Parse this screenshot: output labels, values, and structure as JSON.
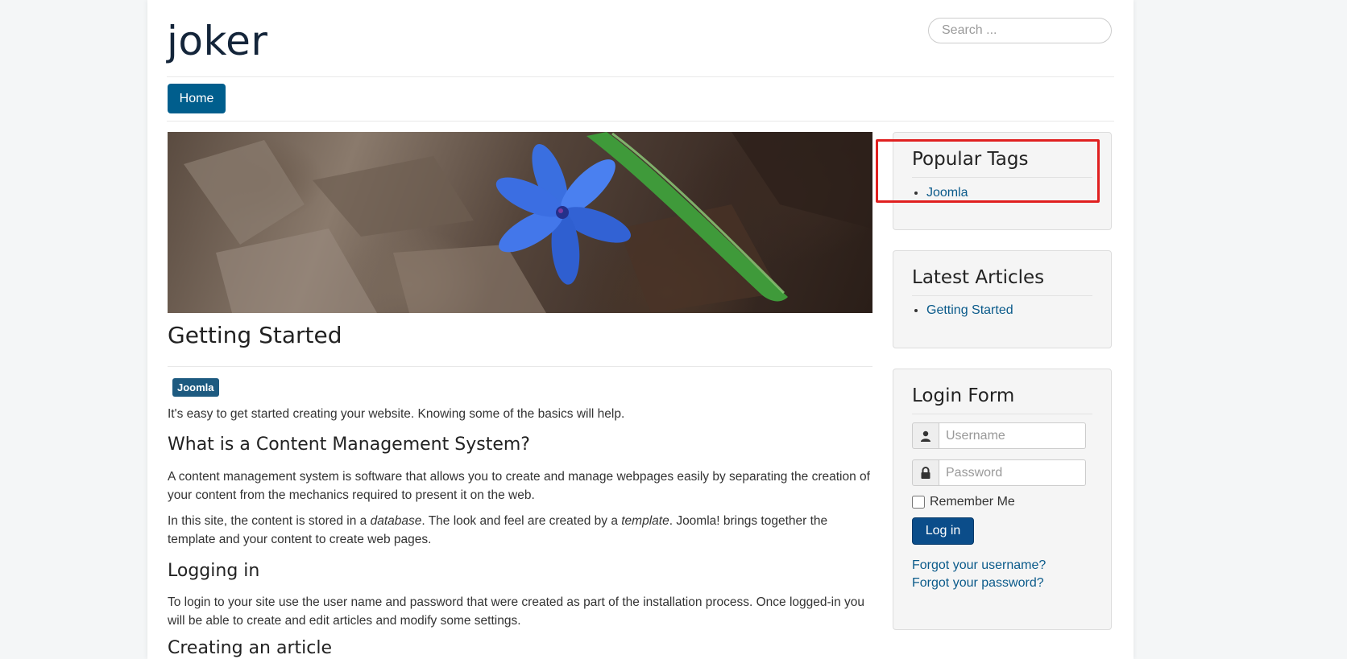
{
  "site": {
    "brand": "joker"
  },
  "search": {
    "placeholder": "Search ..."
  },
  "nav": {
    "items": [
      {
        "label": "Home"
      }
    ]
  },
  "article": {
    "title": "Getting Started",
    "tag": "Joomla",
    "intro": "It's easy to get started creating your website. Knowing some of the basics will help.",
    "sections": [
      {
        "heading": "What is a Content Management System?",
        "p1": "A content management system is software that allows you to create and manage webpages easily by separating the creation of your content from the mechanics required to present it on the web.",
        "p2_a": "In this site, the content is stored in a ",
        "p2_em1": "database",
        "p2_b": ". The look and feel are created by a ",
        "p2_em2": "template",
        "p2_c": ". Joomla! brings together the template and your content to create web pages."
      },
      {
        "heading": "Logging in",
        "p1": "To login to your site use the user name and password that were created as part of the installation process. Once logged-in you will be able to create and edit articles and modify some settings."
      },
      {
        "heading": "Creating an article"
      }
    ]
  },
  "sidebar": {
    "popular_tags": {
      "title": "Popular Tags",
      "items": [
        "Joomla"
      ]
    },
    "latest_articles": {
      "title": "Latest Articles",
      "items": [
        "Getting Started"
      ]
    },
    "login": {
      "title": "Login Form",
      "username_placeholder": "Username",
      "password_placeholder": "Password",
      "remember_label": "Remember Me",
      "login_button": "Log in",
      "forgot_username": "Forgot your username?",
      "forgot_password": "Forgot your password?"
    }
  },
  "colors": {
    "accent": "#005e8d",
    "highlight": "#e02020"
  }
}
